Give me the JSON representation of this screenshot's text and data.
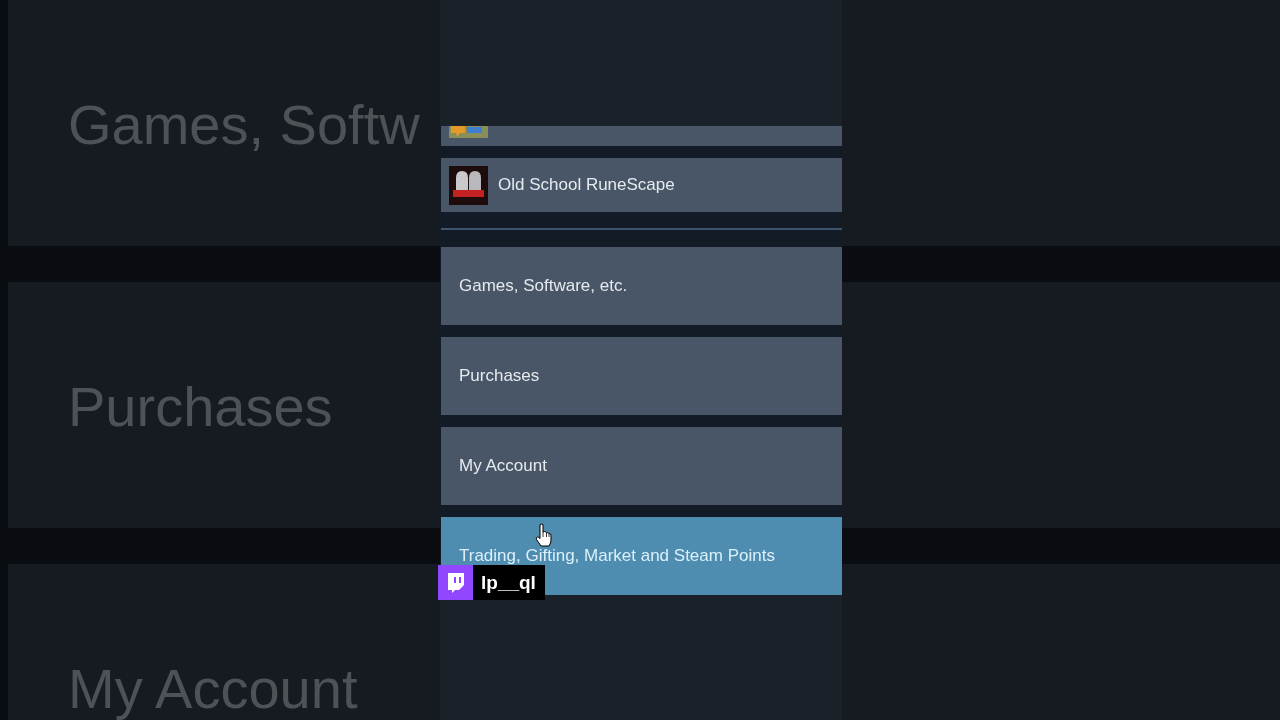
{
  "backdrop": {
    "cards": [
      {
        "label": "Games, Softw"
      },
      {
        "label": "Purchases"
      },
      {
        "label": "My Account"
      }
    ]
  },
  "game_rows": [
    {
      "cut_off": true
    },
    {
      "title": "Old School RuneScape",
      "cut_off": false
    }
  ],
  "help_topics": [
    {
      "label": "Games, Software, etc.",
      "hovered": false
    },
    {
      "label": "Purchases",
      "hovered": false
    },
    {
      "label": "My Account",
      "hovered": false
    },
    {
      "label": "Trading, Gifting, Market and Steam Points",
      "hovered": true
    }
  ],
  "streamer_tag": {
    "username": "lp__ql"
  }
}
